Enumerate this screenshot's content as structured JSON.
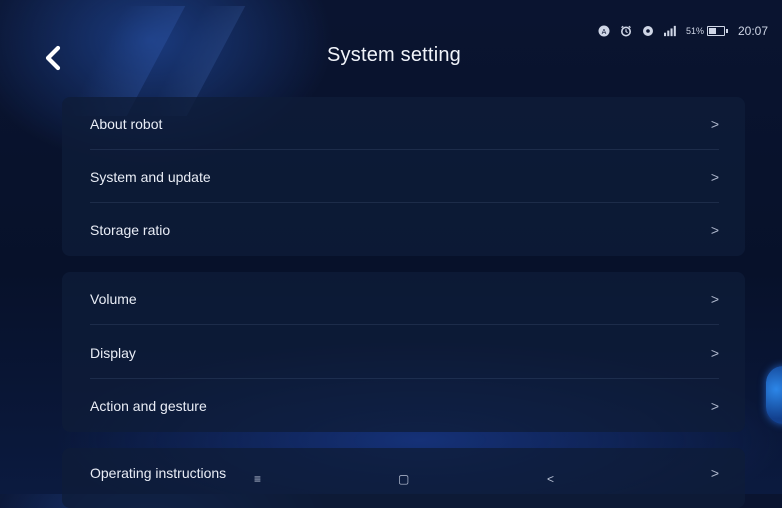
{
  "header": {
    "title": "System setting",
    "back_icon": "chevron-left-icon"
  },
  "status_bar": {
    "icons": [
      "a-badge-icon",
      "alarm-icon",
      "location-icon",
      "signal-icon"
    ],
    "battery_percent": "51%",
    "battery_level": 0.51,
    "time": "20:07"
  },
  "sections": [
    {
      "items": [
        {
          "label": "About robot",
          "chevron": ">"
        },
        {
          "label": "System and update",
          "chevron": ">"
        },
        {
          "label": "Storage ratio",
          "chevron": ">"
        }
      ]
    },
    {
      "items": [
        {
          "label": "Volume",
          "chevron": ">"
        },
        {
          "label": "Display",
          "chevron": ">"
        },
        {
          "label": "Action and gesture",
          "chevron": ">"
        }
      ]
    },
    {
      "items": [
        {
          "label": "Operating instructions",
          "chevron": ">"
        }
      ]
    }
  ],
  "nav_bar": {
    "menu": "≡",
    "home": "▢",
    "back": "<"
  },
  "colors": {
    "background": "#07112a",
    "card": "#0e1c38",
    "text": "#e9edf6",
    "accent_glow": "#2c86e8"
  }
}
